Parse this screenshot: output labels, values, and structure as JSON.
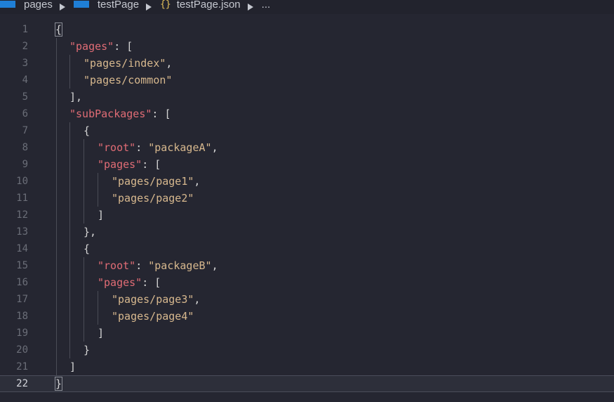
{
  "breadcrumb": {
    "items": [
      "pages",
      "testPage",
      "testPage.json"
    ],
    "json_icon": "{}",
    "ellipsis": "..."
  },
  "editor": {
    "active_line": 22,
    "lines": [
      {
        "n": "1",
        "tokens": [
          {
            "t": "p",
            "v": "{"
          }
        ]
      },
      {
        "n": "2",
        "tokens": [
          {
            "t": "k",
            "v": "\"pages\""
          },
          {
            "t": "p",
            "v": ": ["
          }
        ]
      },
      {
        "n": "3",
        "tokens": [
          {
            "t": "s",
            "v": "\"pages/index\""
          },
          {
            "t": "p",
            "v": ","
          }
        ]
      },
      {
        "n": "4",
        "tokens": [
          {
            "t": "s",
            "v": "\"pages/common\""
          }
        ]
      },
      {
        "n": "5",
        "tokens": [
          {
            "t": "p",
            "v": "],"
          }
        ]
      },
      {
        "n": "6",
        "tokens": [
          {
            "t": "k",
            "v": "\"subPackages\""
          },
          {
            "t": "p",
            "v": ": ["
          }
        ]
      },
      {
        "n": "7",
        "tokens": [
          {
            "t": "p",
            "v": "{"
          }
        ]
      },
      {
        "n": "8",
        "tokens": [
          {
            "t": "k",
            "v": "\"root\""
          },
          {
            "t": "p",
            "v": ": "
          },
          {
            "t": "s",
            "v": "\"packageA\""
          },
          {
            "t": "p",
            "v": ","
          }
        ]
      },
      {
        "n": "9",
        "tokens": [
          {
            "t": "k",
            "v": "\"pages\""
          },
          {
            "t": "p",
            "v": ": ["
          }
        ]
      },
      {
        "n": "10",
        "tokens": [
          {
            "t": "s",
            "v": "\"pages/page1\""
          },
          {
            "t": "p",
            "v": ","
          }
        ]
      },
      {
        "n": "11",
        "tokens": [
          {
            "t": "s",
            "v": "\"pages/page2\""
          }
        ]
      },
      {
        "n": "12",
        "tokens": [
          {
            "t": "p",
            "v": "]"
          }
        ]
      },
      {
        "n": "13",
        "tokens": [
          {
            "t": "p",
            "v": "},"
          }
        ]
      },
      {
        "n": "14",
        "tokens": [
          {
            "t": "p",
            "v": "{"
          }
        ]
      },
      {
        "n": "15",
        "tokens": [
          {
            "t": "k",
            "v": "\"root\""
          },
          {
            "t": "p",
            "v": ": "
          },
          {
            "t": "s",
            "v": "\"packageB\""
          },
          {
            "t": "p",
            "v": ","
          }
        ]
      },
      {
        "n": "16",
        "tokens": [
          {
            "t": "k",
            "v": "\"pages\""
          },
          {
            "t": "p",
            "v": ": ["
          }
        ]
      },
      {
        "n": "17",
        "tokens": [
          {
            "t": "s",
            "v": "\"pages/page3\""
          },
          {
            "t": "p",
            "v": ","
          }
        ]
      },
      {
        "n": "18",
        "tokens": [
          {
            "t": "s",
            "v": "\"pages/page4\""
          }
        ]
      },
      {
        "n": "19",
        "tokens": [
          {
            "t": "p",
            "v": "]"
          }
        ]
      },
      {
        "n": "20",
        "tokens": [
          {
            "t": "p",
            "v": "}"
          }
        ]
      },
      {
        "n": "21",
        "tokens": [
          {
            "t": "p",
            "v": "]"
          }
        ]
      },
      {
        "n": "22",
        "tokens": [
          {
            "t": "p",
            "v": "}"
          }
        ]
      }
    ]
  },
  "colors": {
    "background": "#252631",
    "key": "#e06c75",
    "string": "#d7b88e",
    "punctuation": "#d4d4d4",
    "line_number": "#6b6e78",
    "folder_icon": "#1f7fd6",
    "json_icon": "#e3c15a"
  }
}
